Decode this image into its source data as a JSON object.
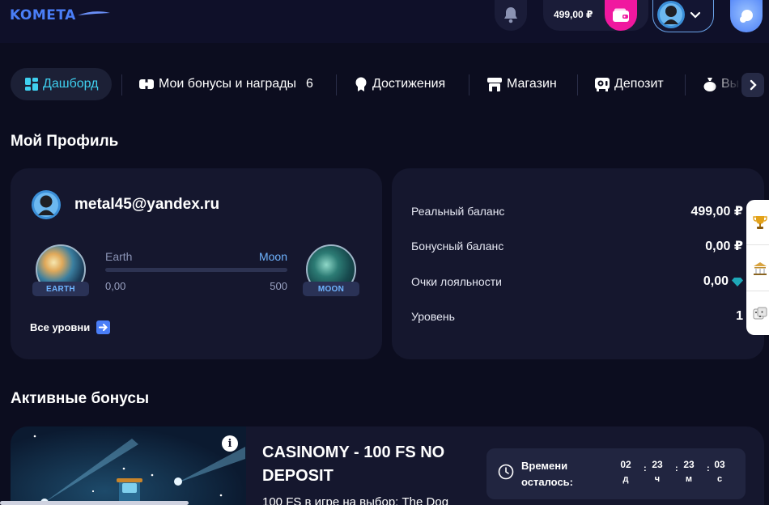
{
  "header": {
    "logo": "KOMETA",
    "balance": "499,00 ₽"
  },
  "nav": {
    "tabs": [
      {
        "label": "Дашборд",
        "icon": "dashboard-icon",
        "active": true
      },
      {
        "label": "Мои бонусы и награды",
        "icon": "gift-icon",
        "count": "6"
      },
      {
        "label": "Достижения",
        "icon": "medal-icon"
      },
      {
        "label": "Магазин",
        "icon": "shop-icon"
      },
      {
        "label": "Депозит",
        "icon": "deposit-icon"
      },
      {
        "label": "Вы",
        "icon": "money-bag-icon"
      }
    ]
  },
  "profile": {
    "section_title": "Мой Профиль",
    "email": "metal45@yandex.ru",
    "level_from": "Earth",
    "level_to": "Moon",
    "from_badge": "EARTH",
    "to_badge": "MOON",
    "progress_current": "0,00",
    "progress_max": "500",
    "progress_fraction": 0,
    "all_levels": "Все уровни"
  },
  "balances": {
    "rows": [
      {
        "label": "Реальный баланс",
        "value": "499,00 ₽"
      },
      {
        "label": "Бонусный баланс",
        "value": "0,00 ₽"
      },
      {
        "label": "Очки лояльности",
        "value": "0,00",
        "icon": "diamond-icon"
      },
      {
        "label": "Уровень",
        "value": "1"
      }
    ]
  },
  "bonuses": {
    "section_title": "Активные бонусы",
    "card": {
      "title": "CASINOMY - 100 FS NO DEPOSIT",
      "description": "100 FS в игре на выбор: The Dog",
      "timer_label_1": "Времени",
      "timer_label_2": "осталось:",
      "timer": [
        {
          "value": "02",
          "unit": "д"
        },
        {
          "value": "23",
          "unit": "ч"
        },
        {
          "value": "23",
          "unit": "м"
        },
        {
          "value": "03",
          "unit": "с"
        }
      ]
    }
  },
  "colors": {
    "background": "#0c0d1f",
    "card": "#15172e",
    "accent": "#4a7ef7",
    "active_tab": "#3fd0f0",
    "wallet": "#f0189f"
  }
}
